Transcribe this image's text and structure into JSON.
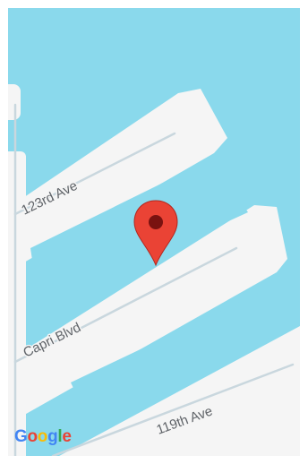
{
  "map": {
    "water_color": "#8ad9ec",
    "land_color": "#f5f5f5",
    "road_line_color": "#c9d7de",
    "streets": [
      {
        "name": "123rd Ave"
      },
      {
        "name": "Capri Blvd"
      },
      {
        "name": "119th Ave"
      }
    ],
    "marker": {
      "icon": "map-pin-icon",
      "color": "#ea4335"
    },
    "attribution": {
      "logo_text": "Google",
      "letter_colors": [
        "#4285f4",
        "#ea4335",
        "#fbbc05",
        "#4285f4",
        "#34a853",
        "#ea4335"
      ]
    }
  }
}
